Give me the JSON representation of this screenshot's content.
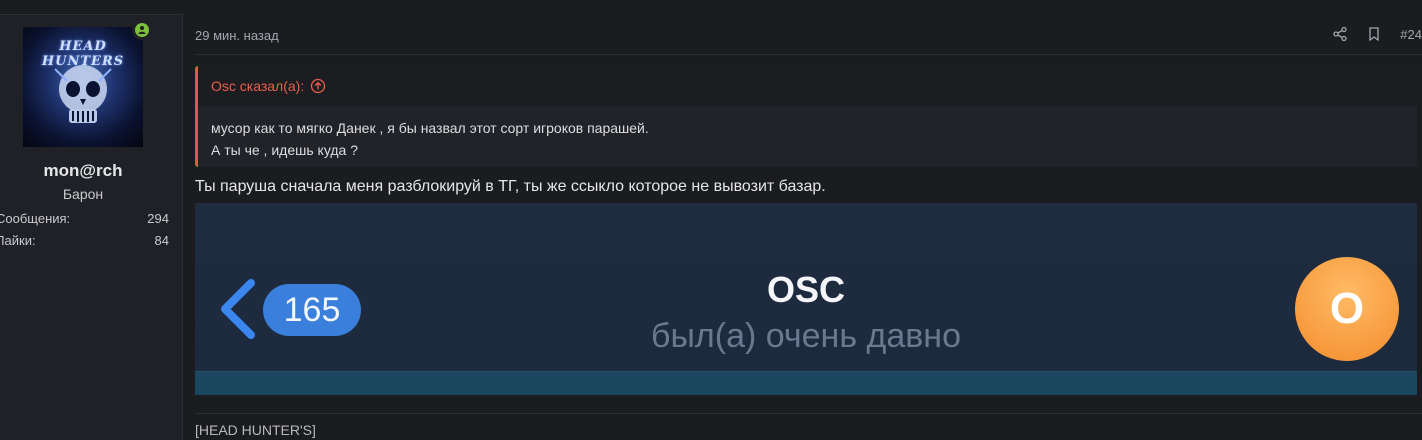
{
  "user": {
    "avatar_text": "HEAD HUNTERS",
    "username": "mon@rch",
    "title": "Барон",
    "stats": [
      {
        "label": "Сообщения:",
        "value": "294"
      },
      {
        "label": "Лайки:",
        "value": "84"
      }
    ],
    "online_color": "#7bbf3a"
  },
  "post": {
    "time": "29 мин. назад",
    "number": "#24",
    "icons": [
      "share-icon",
      "bookmark-icon"
    ]
  },
  "quote": {
    "author_label": "Osc сказал(а):",
    "lines": [
      "мусор как то мягко Данек , я бы назвал этот сорт игроков парашей.",
      "А ты че , идешь куда ?"
    ],
    "accent_color": "#e15a3c"
  },
  "message": "Ты паруша сначала меня разблокируй в ТГ, ты же ссыкло которое не вывозит базар.",
  "attachment": {
    "badge_count": "165",
    "contact_name": "OSC",
    "status": "был(а) очень давно",
    "avatar_letter": "O"
  },
  "signature": "[HEAD HUNTER'S]"
}
